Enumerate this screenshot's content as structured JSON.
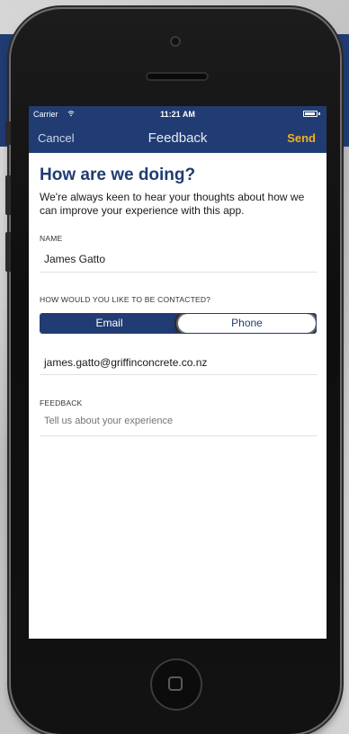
{
  "status_bar": {
    "carrier": "Carrier",
    "time": "11:21 AM"
  },
  "nav": {
    "cancel_label": "Cancel",
    "title": "Feedback",
    "send_label": "Send"
  },
  "form": {
    "heading": "How are we doing?",
    "intro": "We're always keen to hear your thoughts about how we can improve your experience with this app.",
    "name_label": "NAME",
    "name_value": "James Gatto",
    "contact_label": "HOW WOULD YOU LIKE TO BE CONTACTED?",
    "contact_options": [
      "Email",
      "Phone"
    ],
    "contact_selected": "Email",
    "email_value": "james.gatto@griffinconcrete.co.nz",
    "feedback_label": "FEEDBACK",
    "feedback_placeholder": "Tell us about your experience"
  },
  "colors": {
    "brand_navy": "#213c73",
    "send_accent": "#f2b01e",
    "placeholder_gray": "#b8b8b8"
  },
  "icons": {
    "wifi": "wifi-icon",
    "battery": "battery-icon",
    "home": "home-button-icon"
  }
}
